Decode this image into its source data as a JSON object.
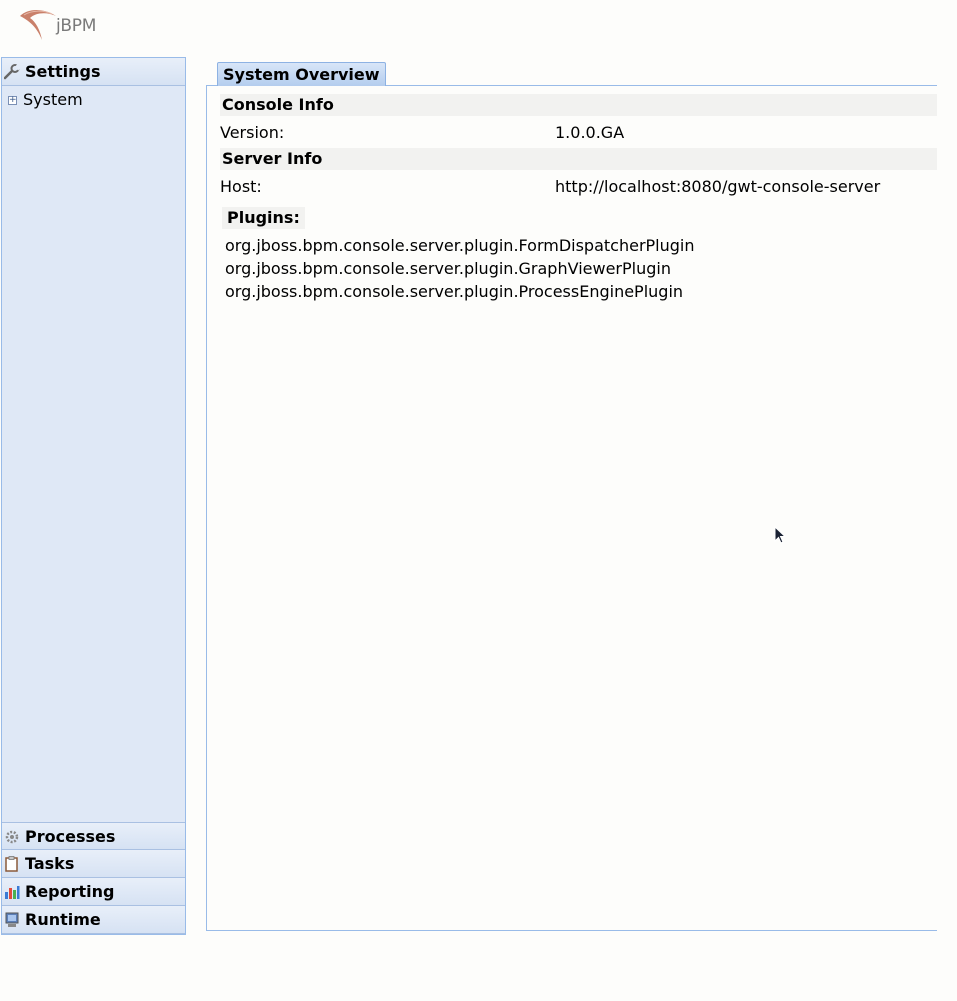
{
  "logo": {
    "text": "jBPM",
    "icon": "jbpm-swoosh-logo"
  },
  "sidebar": {
    "active": {
      "label": "Settings",
      "icon": "wrench-icon"
    },
    "tree": [
      {
        "label": "System",
        "toggle": "+"
      }
    ],
    "bottom": [
      {
        "label": "Processes",
        "icon": "gear-icon"
      },
      {
        "label": "Tasks",
        "icon": "clipboard-icon"
      },
      {
        "label": "Reporting",
        "icon": "bar-chart-icon"
      },
      {
        "label": "Runtime",
        "icon": "monitor-icon"
      }
    ]
  },
  "tab": {
    "label": "System Overview"
  },
  "console_info": {
    "heading": "Console Info",
    "version_label": "Version:",
    "version_value": "1.0.0.GA"
  },
  "server_info": {
    "heading": "Server Info",
    "host_label": "Host:",
    "host_value": "http://localhost:8080/gwt-console-server"
  },
  "plugins": {
    "heading": "Plugins:",
    "items": [
      "org.jboss.bpm.console.server.plugin.FormDispatcherPlugin",
      "org.jboss.bpm.console.server.plugin.GraphViewerPlugin",
      "org.jboss.bpm.console.server.plugin.ProcessEnginePlugin"
    ]
  },
  "colors": {
    "panel_bg": "#dfe8f6",
    "border": "#99bbe8",
    "tab_bg": "#b4cdee",
    "section_bg": "#f2f2f0"
  }
}
